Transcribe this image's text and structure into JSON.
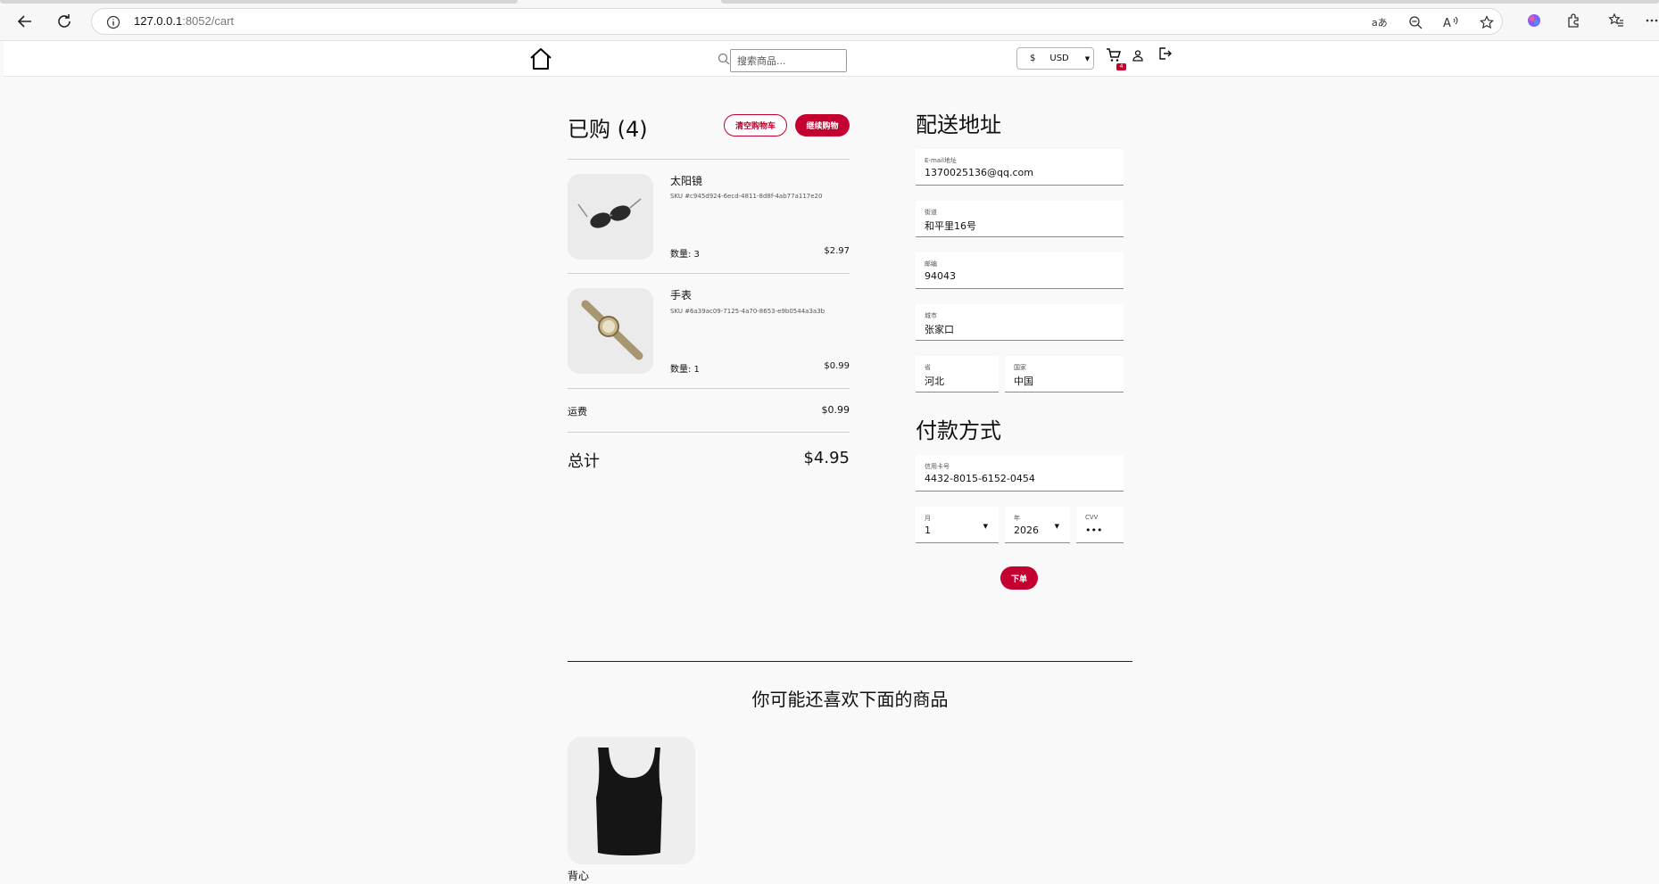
{
  "browser": {
    "url_host": "127.0.0.1",
    "url_path": ":8052/cart"
  },
  "header": {
    "search_placeholder": "搜索商品...",
    "currency_symbol": "$",
    "currency_code": "USD",
    "cart_count": "4"
  },
  "cart": {
    "title": "已购 (4)",
    "clear_label": "清空购物车",
    "continue_label": "继续购物",
    "items": [
      {
        "name": "太阳镜",
        "sku": "SKU #c945d924-6ecd-4811-8d8f-4ab77a117e20",
        "qty": "数量: 3",
        "price": "$2.97",
        "icon": "sunglasses-image"
      },
      {
        "name": "手表",
        "sku": "SKU #6a39ac09-7125-4a70-8653-e9b0544a3a3b",
        "qty": "数量: 1",
        "price": "$0.99",
        "icon": "watch-image"
      }
    ],
    "shipping_label": "运费",
    "shipping_value": "$0.99",
    "total_label": "总计",
    "total_value": "$4.95"
  },
  "shipping": {
    "title": "配送地址",
    "email_label": "E-mail地址",
    "email_value": "1370025136@qq.com",
    "street_label": "街道",
    "street_value": "和平里16号",
    "zip_label": "邮编",
    "zip_value": "94043",
    "city_label": "城市",
    "city_value": "张家口",
    "province_label": "省",
    "province_value": "河北",
    "country_label": "国家",
    "country_value": "中国"
  },
  "payment": {
    "title": "付款方式",
    "card_label": "信用卡号",
    "card_value": "4432-8015-6152-0454",
    "month_label": "月",
    "month_value": "1",
    "year_label": "年",
    "year_value": "2026",
    "cvv_label": "CVV",
    "cvv_value": "•••",
    "order_label": "下单"
  },
  "recommend": {
    "title": "你可能还喜欢下面的商品",
    "items": [
      {
        "name": "背心",
        "icon": "tank-top-image"
      }
    ]
  },
  "colors": {
    "accent": "#c3002f",
    "background": "#f9f9f9"
  }
}
